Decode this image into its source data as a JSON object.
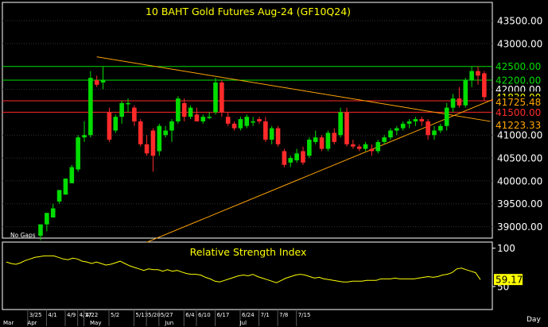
{
  "chart_data": [
    {
      "type": "candlestick",
      "title": "10  BAHT  Gold  Futures  Aug-24  (GF10Q24)",
      "note": "No Gaps",
      "x_axis_label": "Day",
      "y_ticks": [
        43500,
        43000,
        42000,
        41000,
        40500,
        40000,
        39500,
        39000
      ],
      "y_tick_labels": [
        "43500.00",
        "43000.00",
        "42000.00",
        "41000.00",
        "40500.00",
        "40000.00",
        "39500.00",
        "39000.00"
      ],
      "ylim": [
        38750,
        43900
      ],
      "horizontal_lines": [
        {
          "value": 42500,
          "label": "42500.00",
          "color": "#00dd00"
        },
        {
          "value": 42200,
          "label": "42200.00",
          "color": "#00dd00"
        },
        {
          "value": 41750,
          "label": "41750.00",
          "color": "#ff2a2a"
        },
        {
          "value": 41500,
          "label": "41500.00",
          "color": "#ff2a2a"
        }
      ],
      "price_labels": [
        {
          "value": 42000,
          "label": "42000.00",
          "color": "#ffffff"
        },
        {
          "value": 41830,
          "label": "41830.00",
          "color": "#ffff00"
        },
        {
          "value": 41725.48,
          "label": "41725.48",
          "color": "#ffa500"
        },
        {
          "value": 41223.33,
          "label": "41223.33",
          "color": "#ffa500"
        }
      ],
      "trendlines": [
        {
          "from": [
            9,
            42710
          ],
          "to": [
            72,
            41300
          ],
          "color": "#ffa500"
        },
        {
          "from": [
            17,
            38660
          ],
          "to": [
            74,
            41870
          ],
          "color": "#ffa500"
        }
      ],
      "x_date_labels": [
        "3/25",
        "4/1",
        "4/9",
        "4/17",
        "4/22",
        "5/2",
        "5/13",
        "5/20",
        "5/27",
        "6/4",
        "6/10",
        "6/17",
        "6/24",
        "7/1",
        "7/8",
        "7/15"
      ],
      "x_date_label_positions": [
        1,
        4,
        7,
        9,
        10,
        14,
        18,
        20,
        22,
        26,
        28,
        31,
        35,
        38,
        41,
        44
      ],
      "x_month_labels": [
        "Mar",
        "Apr",
        "May",
        "Jun",
        "Jul"
      ],
      "x_month_label_positions": [
        0,
        4,
        14,
        26,
        38
      ],
      "candles": [
        {
          "o": 38800,
          "h": 39050,
          "l": 38700,
          "c": 39050
        },
        {
          "o": 39050,
          "h": 39300,
          "l": 38900,
          "c": 39300
        },
        {
          "o": 39200,
          "h": 39500,
          "l": 39200,
          "c": 39400
        },
        {
          "o": 39550,
          "h": 39800,
          "l": 39500,
          "c": 39800
        },
        {
          "o": 39700,
          "h": 40050,
          "l": 39700,
          "c": 40050
        },
        {
          "o": 39950,
          "h": 40350,
          "l": 39950,
          "c": 40300
        },
        {
          "o": 40250,
          "h": 41000,
          "l": 40200,
          "c": 40950
        },
        {
          "o": 40950,
          "h": 41300,
          "l": 40850,
          "c": 41000
        },
        {
          "o": 41000,
          "h": 42400,
          "l": 40950,
          "c": 42250
        },
        {
          "o": 42200,
          "h": 42300,
          "l": 42050,
          "c": 42100
        },
        {
          "o": 42150,
          "h": 42500,
          "l": 42000,
          "c": 42200
        },
        {
          "o": 41500,
          "h": 41600,
          "l": 40850,
          "c": 40900
        },
        {
          "o": 41100,
          "h": 41450,
          "l": 41050,
          "c": 41400
        },
        {
          "o": 41400,
          "h": 41750,
          "l": 41250,
          "c": 41700
        },
        {
          "o": 41700,
          "h": 41800,
          "l": 41500,
          "c": 41700
        },
        {
          "o": 41600,
          "h": 41650,
          "l": 41200,
          "c": 41300
        },
        {
          "o": 41300,
          "h": 41350,
          "l": 40750,
          "c": 40800
        },
        {
          "o": 40800,
          "h": 41000,
          "l": 40550,
          "c": 40600
        },
        {
          "o": 41100,
          "h": 41150,
          "l": 40200,
          "c": 40550
        },
        {
          "o": 40650,
          "h": 41250,
          "l": 40550,
          "c": 41200
        },
        {
          "o": 41000,
          "h": 41200,
          "l": 40950,
          "c": 41100
        },
        {
          "o": 41100,
          "h": 41350,
          "l": 40850,
          "c": 41300
        },
        {
          "o": 41300,
          "h": 41850,
          "l": 41250,
          "c": 41800
        },
        {
          "o": 41700,
          "h": 41800,
          "l": 41300,
          "c": 41400
        },
        {
          "o": 41400,
          "h": 41650,
          "l": 41350,
          "c": 41600
        },
        {
          "o": 41450,
          "h": 41600,
          "l": 41300,
          "c": 41300
        },
        {
          "o": 41300,
          "h": 41450,
          "l": 41250,
          "c": 41400
        },
        {
          "o": 41400,
          "h": 41500,
          "l": 41350,
          "c": 41400
        },
        {
          "o": 41500,
          "h": 42250,
          "l": 41450,
          "c": 42150
        },
        {
          "o": 42150,
          "h": 42200,
          "l": 41400,
          "c": 41500
        },
        {
          "o": 41400,
          "h": 41500,
          "l": 41200,
          "c": 41250
        },
        {
          "o": 41250,
          "h": 41300,
          "l": 41100,
          "c": 41150
        },
        {
          "o": 41150,
          "h": 41400,
          "l": 41100,
          "c": 41350
        },
        {
          "o": 41200,
          "h": 41450,
          "l": 41150,
          "c": 41400
        },
        {
          "o": 41300,
          "h": 41400,
          "l": 41200,
          "c": 41300
        },
        {
          "o": 41350,
          "h": 41400,
          "l": 41250,
          "c": 41300
        },
        {
          "o": 41300,
          "h": 41400,
          "l": 40850,
          "c": 40900
        },
        {
          "o": 40900,
          "h": 41200,
          "l": 40800,
          "c": 41150
        },
        {
          "o": 41150,
          "h": 41200,
          "l": 40750,
          "c": 40800
        },
        {
          "o": 40650,
          "h": 40700,
          "l": 40300,
          "c": 40350
        },
        {
          "o": 40400,
          "h": 40550,
          "l": 40300,
          "c": 40500
        },
        {
          "o": 40450,
          "h": 40700,
          "l": 40400,
          "c": 40600
        },
        {
          "o": 40650,
          "h": 40750,
          "l": 40350,
          "c": 40400
        },
        {
          "o": 40550,
          "h": 40950,
          "l": 40500,
          "c": 40900
        },
        {
          "o": 40850,
          "h": 41100,
          "l": 40800,
          "c": 40950
        },
        {
          "o": 40950,
          "h": 41000,
          "l": 40650,
          "c": 40700
        },
        {
          "o": 40700,
          "h": 41100,
          "l": 40650,
          "c": 41050
        },
        {
          "o": 41050,
          "h": 41150,
          "l": 40800,
          "c": 40850
        },
        {
          "o": 41000,
          "h": 41600,
          "l": 40950,
          "c": 41500
        },
        {
          "o": 41500,
          "h": 41600,
          "l": 40750,
          "c": 40800
        },
        {
          "o": 40800,
          "h": 40900,
          "l": 40700,
          "c": 40750
        },
        {
          "o": 40750,
          "h": 40800,
          "l": 40650,
          "c": 40700
        },
        {
          "o": 40700,
          "h": 40850,
          "l": 40650,
          "c": 40800
        },
        {
          "o": 40700,
          "h": 40800,
          "l": 40550,
          "c": 40650
        },
        {
          "o": 40650,
          "h": 40900,
          "l": 40600,
          "c": 40850
        },
        {
          "o": 40850,
          "h": 41000,
          "l": 40800,
          "c": 40950
        },
        {
          "o": 40950,
          "h": 41150,
          "l": 40900,
          "c": 41100
        },
        {
          "o": 41100,
          "h": 41200,
          "l": 41000,
          "c": 41150
        },
        {
          "o": 41150,
          "h": 41300,
          "l": 41100,
          "c": 41250
        },
        {
          "o": 41250,
          "h": 41350,
          "l": 41150,
          "c": 41300
        },
        {
          "o": 41300,
          "h": 41400,
          "l": 41200,
          "c": 41350
        },
        {
          "o": 41350,
          "h": 41400,
          "l": 41200,
          "c": 41300
        },
        {
          "o": 41300,
          "h": 41350,
          "l": 40900,
          "c": 41000
        },
        {
          "o": 41000,
          "h": 41200,
          "l": 40900,
          "c": 41100
        },
        {
          "o": 41100,
          "h": 41250,
          "l": 41050,
          "c": 41200
        },
        {
          "o": 41200,
          "h": 41700,
          "l": 41100,
          "c": 41600
        },
        {
          "o": 41600,
          "h": 41900,
          "l": 41500,
          "c": 41800
        },
        {
          "o": 41800,
          "h": 42050,
          "l": 41600,
          "c": 41650
        },
        {
          "o": 41650,
          "h": 42250,
          "l": 41600,
          "c": 42200
        },
        {
          "o": 42200,
          "h": 42500,
          "l": 42050,
          "c": 42400
        },
        {
          "o": 42400,
          "h": 42500,
          "l": 42100,
          "c": 42300
        },
        {
          "o": 42350,
          "h": 42400,
          "l": 41750,
          "c": 41830
        }
      ]
    },
    {
      "type": "line",
      "title": "Relative  Strength  Index",
      "y_ticks": [
        100,
        50
      ],
      "y_tick_labels": [
        "100",
        "50"
      ],
      "ylim": [
        20,
        108
      ],
      "last_value": 59.17,
      "last_value_label": "59.17",
      "color": "#ffff00",
      "values": [
        82,
        80,
        79,
        81,
        84,
        86,
        88,
        89,
        90,
        90,
        90,
        88,
        86,
        85,
        87,
        86,
        83,
        82,
        80,
        82,
        80,
        78,
        79,
        81,
        83,
        80,
        77,
        75,
        73,
        71,
        73,
        72,
        72,
        70,
        72,
        70,
        71,
        69,
        67,
        66,
        66,
        65,
        62,
        60,
        57,
        56,
        58,
        60,
        62,
        64,
        65,
        64,
        66,
        63,
        61,
        59,
        57,
        55,
        58,
        61,
        63,
        65,
        66,
        65,
        63,
        61,
        62,
        60,
        59,
        58,
        57,
        56,
        56,
        57,
        57,
        57,
        58,
        58,
        58,
        60,
        60,
        60,
        61,
        60,
        60,
        60,
        60,
        61,
        62,
        63,
        62,
        63,
        65,
        66,
        68,
        73,
        74,
        72,
        70,
        68,
        59
      ]
    }
  ]
}
